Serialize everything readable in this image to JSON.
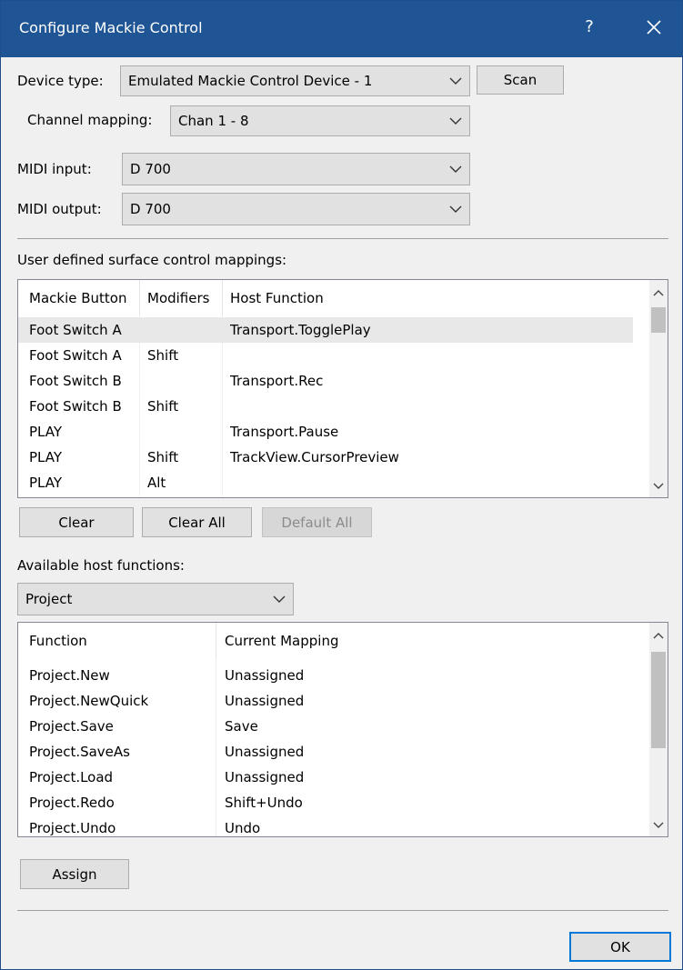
{
  "window": {
    "title": "Configure Mackie Control",
    "help_label": "?"
  },
  "device": {
    "device_type_label": "Device type:",
    "device_type_value": "Emulated Mackie Control Device - 1",
    "scan_label": "Scan",
    "channel_mapping_label": "Channel mapping:",
    "channel_mapping_value": "Chan 1 - 8",
    "midi_input_label": "MIDI input:",
    "midi_input_value": "D 700",
    "midi_output_label": "MIDI output:",
    "midi_output_value": "D 700"
  },
  "mappings": {
    "section_label": "User defined surface control mappings:",
    "columns": [
      "Mackie Button",
      "Modifiers",
      "Host Function"
    ],
    "rows": [
      [
        "Foot Switch A",
        "",
        "Transport.TogglePlay"
      ],
      [
        "Foot Switch A",
        "Shift",
        ""
      ],
      [
        "Foot Switch B",
        "",
        "Transport.Rec"
      ],
      [
        "Foot Switch B",
        "Shift",
        ""
      ],
      [
        "PLAY",
        "",
        "Transport.Pause"
      ],
      [
        "PLAY",
        "Shift",
        "TrackView.CursorPreview"
      ],
      [
        "PLAY",
        "Alt",
        ""
      ]
    ],
    "clear_label": "Clear",
    "clear_all_label": "Clear All",
    "default_all_label": "Default All"
  },
  "functions": {
    "section_label": "Available host functions:",
    "category_value": "Project",
    "columns": [
      "Function",
      "Current Mapping"
    ],
    "rows": [
      [
        "Project.New",
        "Unassigned"
      ],
      [
        "Project.NewQuick",
        "Unassigned"
      ],
      [
        "Project.Save",
        "Save"
      ],
      [
        "Project.SaveAs",
        "Unassigned"
      ],
      [
        "Project.Load",
        "Unassigned"
      ],
      [
        "Project.Redo",
        "Shift+Undo"
      ],
      [
        "Project.Undo",
        "Undo"
      ]
    ],
    "assign_label": "Assign"
  },
  "footer": {
    "ok_label": "OK"
  },
  "colors": {
    "titlebar": "#1f5594",
    "dialog_bg": "#f0f0f0",
    "default_button_border": "#0078d7"
  }
}
